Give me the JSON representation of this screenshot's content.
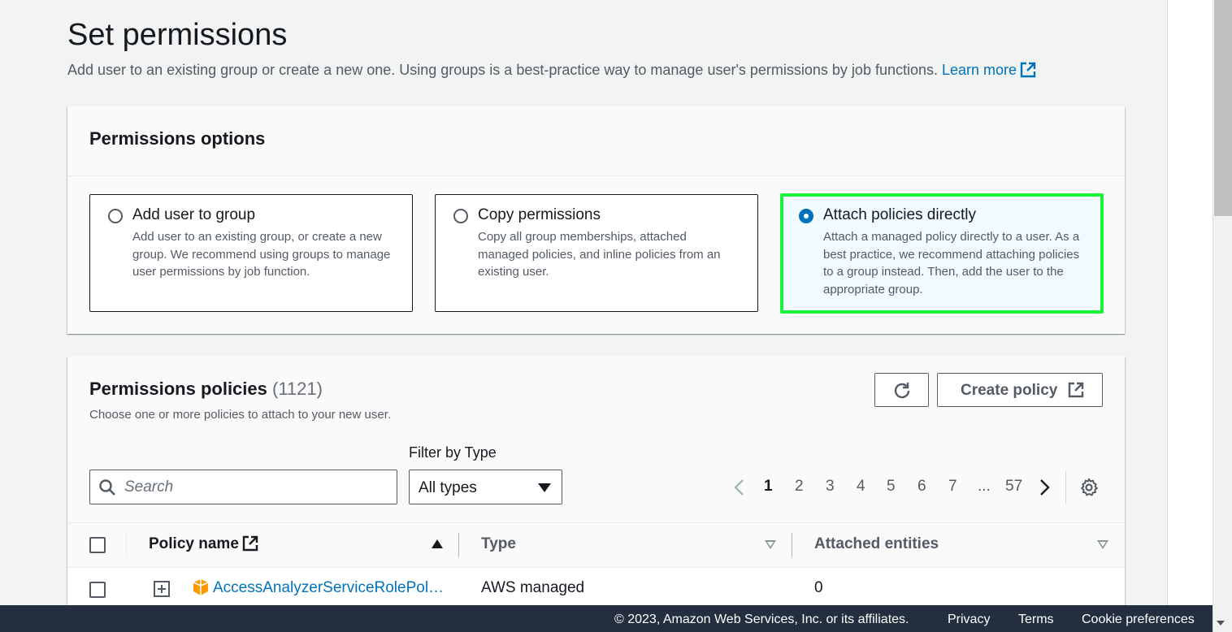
{
  "page": {
    "title": "Set permissions",
    "description": "Add user to an existing group or create a new one. Using groups is a best-practice way to manage user's permissions by job functions.",
    "learn_more": "Learn more"
  },
  "options_panel": {
    "title": "Permissions options",
    "tiles": [
      {
        "label": "Add user to group",
        "description": "Add user to an existing group, or create a new group. We recommend using groups to manage user permissions by job function.",
        "selected": false
      },
      {
        "label": "Copy permissions",
        "description": "Copy all group memberships, attached managed policies, and inline policies from an existing user.",
        "selected": false
      },
      {
        "label": "Attach policies directly",
        "description": "Attach a managed policy directly to a user. As a best practice, we recommend attaching policies to a group instead. Then, add the user to the appropriate group.",
        "selected": true
      }
    ],
    "highlight_color": "#1bf23b"
  },
  "policies_panel": {
    "title": "Permissions policies",
    "count": "(1121)",
    "description": "Choose one or more policies to attach to your new user.",
    "create_policy_label": "Create policy",
    "search_placeholder": "Search",
    "filter_label": "Filter by Type",
    "filter_value": "All types",
    "pagination": {
      "pages": [
        "1",
        "2",
        "3",
        "4",
        "5",
        "6",
        "7",
        "...",
        "57"
      ],
      "current": "1"
    },
    "columns": [
      "Policy name",
      "Type",
      "Attached entities"
    ],
    "rows": [
      {
        "policy_name": "AccessAnalyzerServiceRolePol…",
        "type": "AWS managed",
        "attached_entities": "0"
      }
    ]
  },
  "footer": {
    "copyright": "© 2023, Amazon Web Services, Inc. or its affiliates.",
    "links": [
      "Privacy",
      "Terms",
      "Cookie preferences"
    ]
  },
  "colors": {
    "link": "#0073bb",
    "footer_bg": "#232f3e",
    "selected_radio": "#0073bb"
  }
}
